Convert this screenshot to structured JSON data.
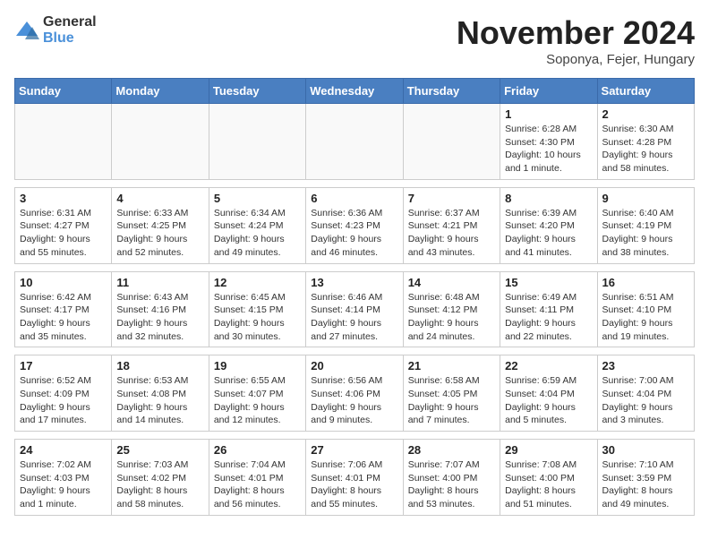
{
  "logo": {
    "general": "General",
    "blue": "Blue"
  },
  "title": "November 2024",
  "subtitle": "Soponya, Fejer, Hungary",
  "weekdays": [
    "Sunday",
    "Monday",
    "Tuesday",
    "Wednesday",
    "Thursday",
    "Friday",
    "Saturday"
  ],
  "weeks": [
    [
      {
        "day": "",
        "detail": ""
      },
      {
        "day": "",
        "detail": ""
      },
      {
        "day": "",
        "detail": ""
      },
      {
        "day": "",
        "detail": ""
      },
      {
        "day": "",
        "detail": ""
      },
      {
        "day": "1",
        "detail": "Sunrise: 6:28 AM\nSunset: 4:30 PM\nDaylight: 10 hours and 1 minute."
      },
      {
        "day": "2",
        "detail": "Sunrise: 6:30 AM\nSunset: 4:28 PM\nDaylight: 9 hours and 58 minutes."
      }
    ],
    [
      {
        "day": "3",
        "detail": "Sunrise: 6:31 AM\nSunset: 4:27 PM\nDaylight: 9 hours and 55 minutes."
      },
      {
        "day": "4",
        "detail": "Sunrise: 6:33 AM\nSunset: 4:25 PM\nDaylight: 9 hours and 52 minutes."
      },
      {
        "day": "5",
        "detail": "Sunrise: 6:34 AM\nSunset: 4:24 PM\nDaylight: 9 hours and 49 minutes."
      },
      {
        "day": "6",
        "detail": "Sunrise: 6:36 AM\nSunset: 4:23 PM\nDaylight: 9 hours and 46 minutes."
      },
      {
        "day": "7",
        "detail": "Sunrise: 6:37 AM\nSunset: 4:21 PM\nDaylight: 9 hours and 43 minutes."
      },
      {
        "day": "8",
        "detail": "Sunrise: 6:39 AM\nSunset: 4:20 PM\nDaylight: 9 hours and 41 minutes."
      },
      {
        "day": "9",
        "detail": "Sunrise: 6:40 AM\nSunset: 4:19 PM\nDaylight: 9 hours and 38 minutes."
      }
    ],
    [
      {
        "day": "10",
        "detail": "Sunrise: 6:42 AM\nSunset: 4:17 PM\nDaylight: 9 hours and 35 minutes."
      },
      {
        "day": "11",
        "detail": "Sunrise: 6:43 AM\nSunset: 4:16 PM\nDaylight: 9 hours and 32 minutes."
      },
      {
        "day": "12",
        "detail": "Sunrise: 6:45 AM\nSunset: 4:15 PM\nDaylight: 9 hours and 30 minutes."
      },
      {
        "day": "13",
        "detail": "Sunrise: 6:46 AM\nSunset: 4:14 PM\nDaylight: 9 hours and 27 minutes."
      },
      {
        "day": "14",
        "detail": "Sunrise: 6:48 AM\nSunset: 4:12 PM\nDaylight: 9 hours and 24 minutes."
      },
      {
        "day": "15",
        "detail": "Sunrise: 6:49 AM\nSunset: 4:11 PM\nDaylight: 9 hours and 22 minutes."
      },
      {
        "day": "16",
        "detail": "Sunrise: 6:51 AM\nSunset: 4:10 PM\nDaylight: 9 hours and 19 minutes."
      }
    ],
    [
      {
        "day": "17",
        "detail": "Sunrise: 6:52 AM\nSunset: 4:09 PM\nDaylight: 9 hours and 17 minutes."
      },
      {
        "day": "18",
        "detail": "Sunrise: 6:53 AM\nSunset: 4:08 PM\nDaylight: 9 hours and 14 minutes."
      },
      {
        "day": "19",
        "detail": "Sunrise: 6:55 AM\nSunset: 4:07 PM\nDaylight: 9 hours and 12 minutes."
      },
      {
        "day": "20",
        "detail": "Sunrise: 6:56 AM\nSunset: 4:06 PM\nDaylight: 9 hours and 9 minutes."
      },
      {
        "day": "21",
        "detail": "Sunrise: 6:58 AM\nSunset: 4:05 PM\nDaylight: 9 hours and 7 minutes."
      },
      {
        "day": "22",
        "detail": "Sunrise: 6:59 AM\nSunset: 4:04 PM\nDaylight: 9 hours and 5 minutes."
      },
      {
        "day": "23",
        "detail": "Sunrise: 7:00 AM\nSunset: 4:04 PM\nDaylight: 9 hours and 3 minutes."
      }
    ],
    [
      {
        "day": "24",
        "detail": "Sunrise: 7:02 AM\nSunset: 4:03 PM\nDaylight: 9 hours and 1 minute."
      },
      {
        "day": "25",
        "detail": "Sunrise: 7:03 AM\nSunset: 4:02 PM\nDaylight: 8 hours and 58 minutes."
      },
      {
        "day": "26",
        "detail": "Sunrise: 7:04 AM\nSunset: 4:01 PM\nDaylight: 8 hours and 56 minutes."
      },
      {
        "day": "27",
        "detail": "Sunrise: 7:06 AM\nSunset: 4:01 PM\nDaylight: 8 hours and 55 minutes."
      },
      {
        "day": "28",
        "detail": "Sunrise: 7:07 AM\nSunset: 4:00 PM\nDaylight: 8 hours and 53 minutes."
      },
      {
        "day": "29",
        "detail": "Sunrise: 7:08 AM\nSunset: 4:00 PM\nDaylight: 8 hours and 51 minutes."
      },
      {
        "day": "30",
        "detail": "Sunrise: 7:10 AM\nSunset: 3:59 PM\nDaylight: 8 hours and 49 minutes."
      }
    ]
  ]
}
